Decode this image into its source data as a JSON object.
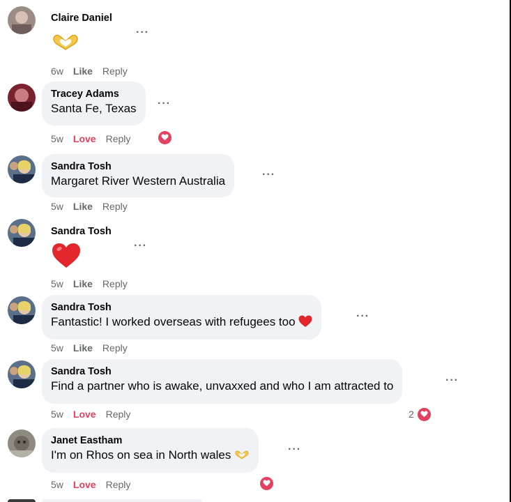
{
  "comments": [
    {
      "author": "Claire Daniel",
      "text": "",
      "emoji": "heart-hands",
      "time": "6w",
      "action": "Like",
      "reply": "Reply",
      "reaction": "",
      "reaction_count": ""
    },
    {
      "author": "Tracey Adams",
      "text": "Santa Fe, Texas",
      "emoji": "",
      "time": "5w",
      "action": "Love",
      "reply": "Reply",
      "reaction": "love",
      "reaction_count": ""
    },
    {
      "author": "Sandra Tosh",
      "text": "Margaret River Western Australia",
      "emoji": "",
      "time": "5w",
      "action": "Like",
      "reply": "Reply",
      "reaction": "",
      "reaction_count": ""
    },
    {
      "author": "Sandra Tosh",
      "text": "",
      "emoji": "red-heart",
      "time": "5w",
      "action": "Like",
      "reply": "Reply",
      "reaction": "",
      "reaction_count": ""
    },
    {
      "author": "Sandra Tosh",
      "text": "Fantastic! I worked overseas with refugees too",
      "emoji": "red-heart",
      "time": "5w",
      "action": "Like",
      "reply": "Reply",
      "reaction": "",
      "reaction_count": ""
    },
    {
      "author": "Sandra Tosh",
      "text": "Find a partner who is awake, unvaxxed and who I am attracted to",
      "emoji": "",
      "time": "5w",
      "action": "Love",
      "reply": "Reply",
      "reaction": "love",
      "reaction_count": "2"
    },
    {
      "author": "Janet Eastham",
      "text": "I'm on Rhos on sea in North wales",
      "emoji": "heart-hands",
      "time": "5w",
      "action": "Love",
      "reply": "Reply",
      "reaction": "love",
      "reaction_count": ""
    }
  ],
  "more_options_label": "···",
  "colors": {
    "bubble": "#f0f2f5",
    "meta": "#65676b",
    "love": "#e4405f"
  }
}
